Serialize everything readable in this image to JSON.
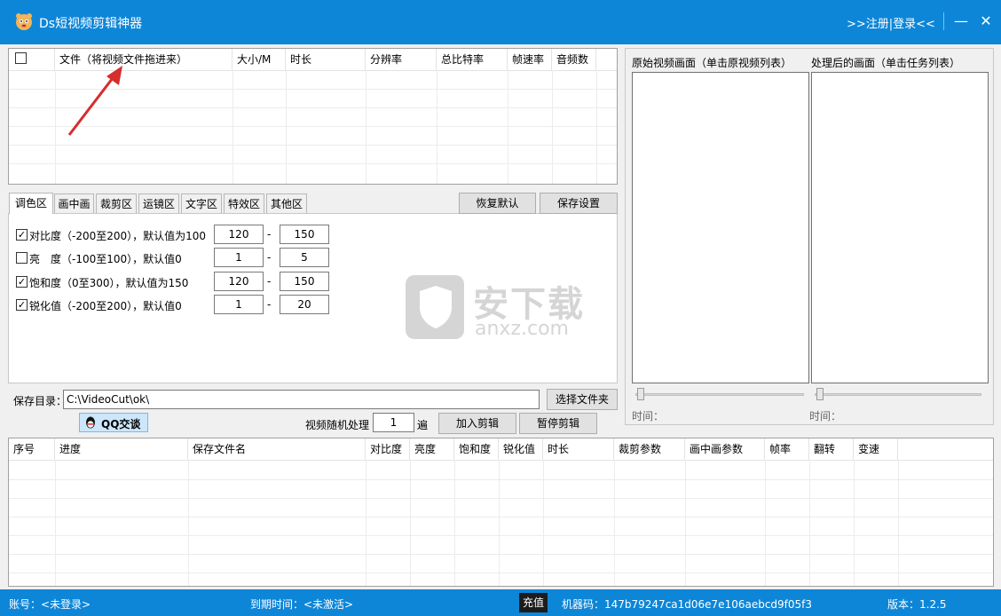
{
  "window": {
    "title": "Ds短视频剪辑神器",
    "login_link": ">>注册|登录<<",
    "minimize": "—",
    "close": "✕"
  },
  "file_table": {
    "columns": [
      "文件（将视频文件拖进来）",
      "大小/M",
      "时长",
      "分辨率",
      "总比特率",
      "帧速率",
      "音频数"
    ],
    "rows": []
  },
  "preview": {
    "original_label": "原始视频画面（单击原视频列表）",
    "processed_label": "处理后的画面（单击任务列表）",
    "time_label_left": "时间：",
    "time_label_right": "时间：",
    "original_slider_position": 0,
    "processed_slider_position": 0
  },
  "tabs": [
    {
      "label": "调色区",
      "active": true
    },
    {
      "label": "画中画",
      "active": false
    },
    {
      "label": "裁剪区",
      "active": false
    },
    {
      "label": "运镜区",
      "active": false
    },
    {
      "label": "文字区",
      "active": false
    },
    {
      "label": "特效区",
      "active": false
    },
    {
      "label": "其他区",
      "active": false
    }
  ],
  "settings_buttons": {
    "restore": "恢复默认",
    "save": "保存设置"
  },
  "color_settings": [
    {
      "checked": true,
      "label": "对比度（-200至200），默认值为100",
      "min": "120",
      "max": "150"
    },
    {
      "checked": false,
      "label": "亮　度（-100至100），默认值0",
      "min": "1",
      "max": "5"
    },
    {
      "checked": true,
      "label": "饱和度（0至300），默认值为150",
      "min": "120",
      "max": "150"
    },
    {
      "checked": true,
      "label": "锐化值（-200至200），默认值0",
      "min": "1",
      "max": "20"
    }
  ],
  "range_dash": "-",
  "save_dir": {
    "label": "保存目录：",
    "value": "C:\\VideoCut\\ok\\",
    "choose_button": "选择文件夹"
  },
  "qq_button": "QQ交谈",
  "random": {
    "label": "视频随机处理",
    "value": "1",
    "unit": "遍"
  },
  "actions": {
    "add": "加入剪辑",
    "pause": "暂停剪辑"
  },
  "task_table": {
    "columns": [
      "序号",
      "进度",
      "保存文件名",
      "对比度",
      "亮度",
      "饱和度",
      "锐化值",
      "时长",
      "裁剪参数",
      "画中画参数",
      "帧率",
      "翻转",
      "变速"
    ],
    "rows": []
  },
  "status": {
    "account": "账号：<未登录>",
    "expire": "到期时间：<未激活>",
    "recharge": "充值",
    "machine_code": "机器码：147b79247ca1d06e7e106aebcd9f05f3",
    "version": "版本：1.2.5"
  },
  "watermark": {
    "text": "安下载",
    "sub": "anxz.com"
  },
  "colors": {
    "accent": "#0d86d8",
    "arrow": "#d62d2d"
  }
}
